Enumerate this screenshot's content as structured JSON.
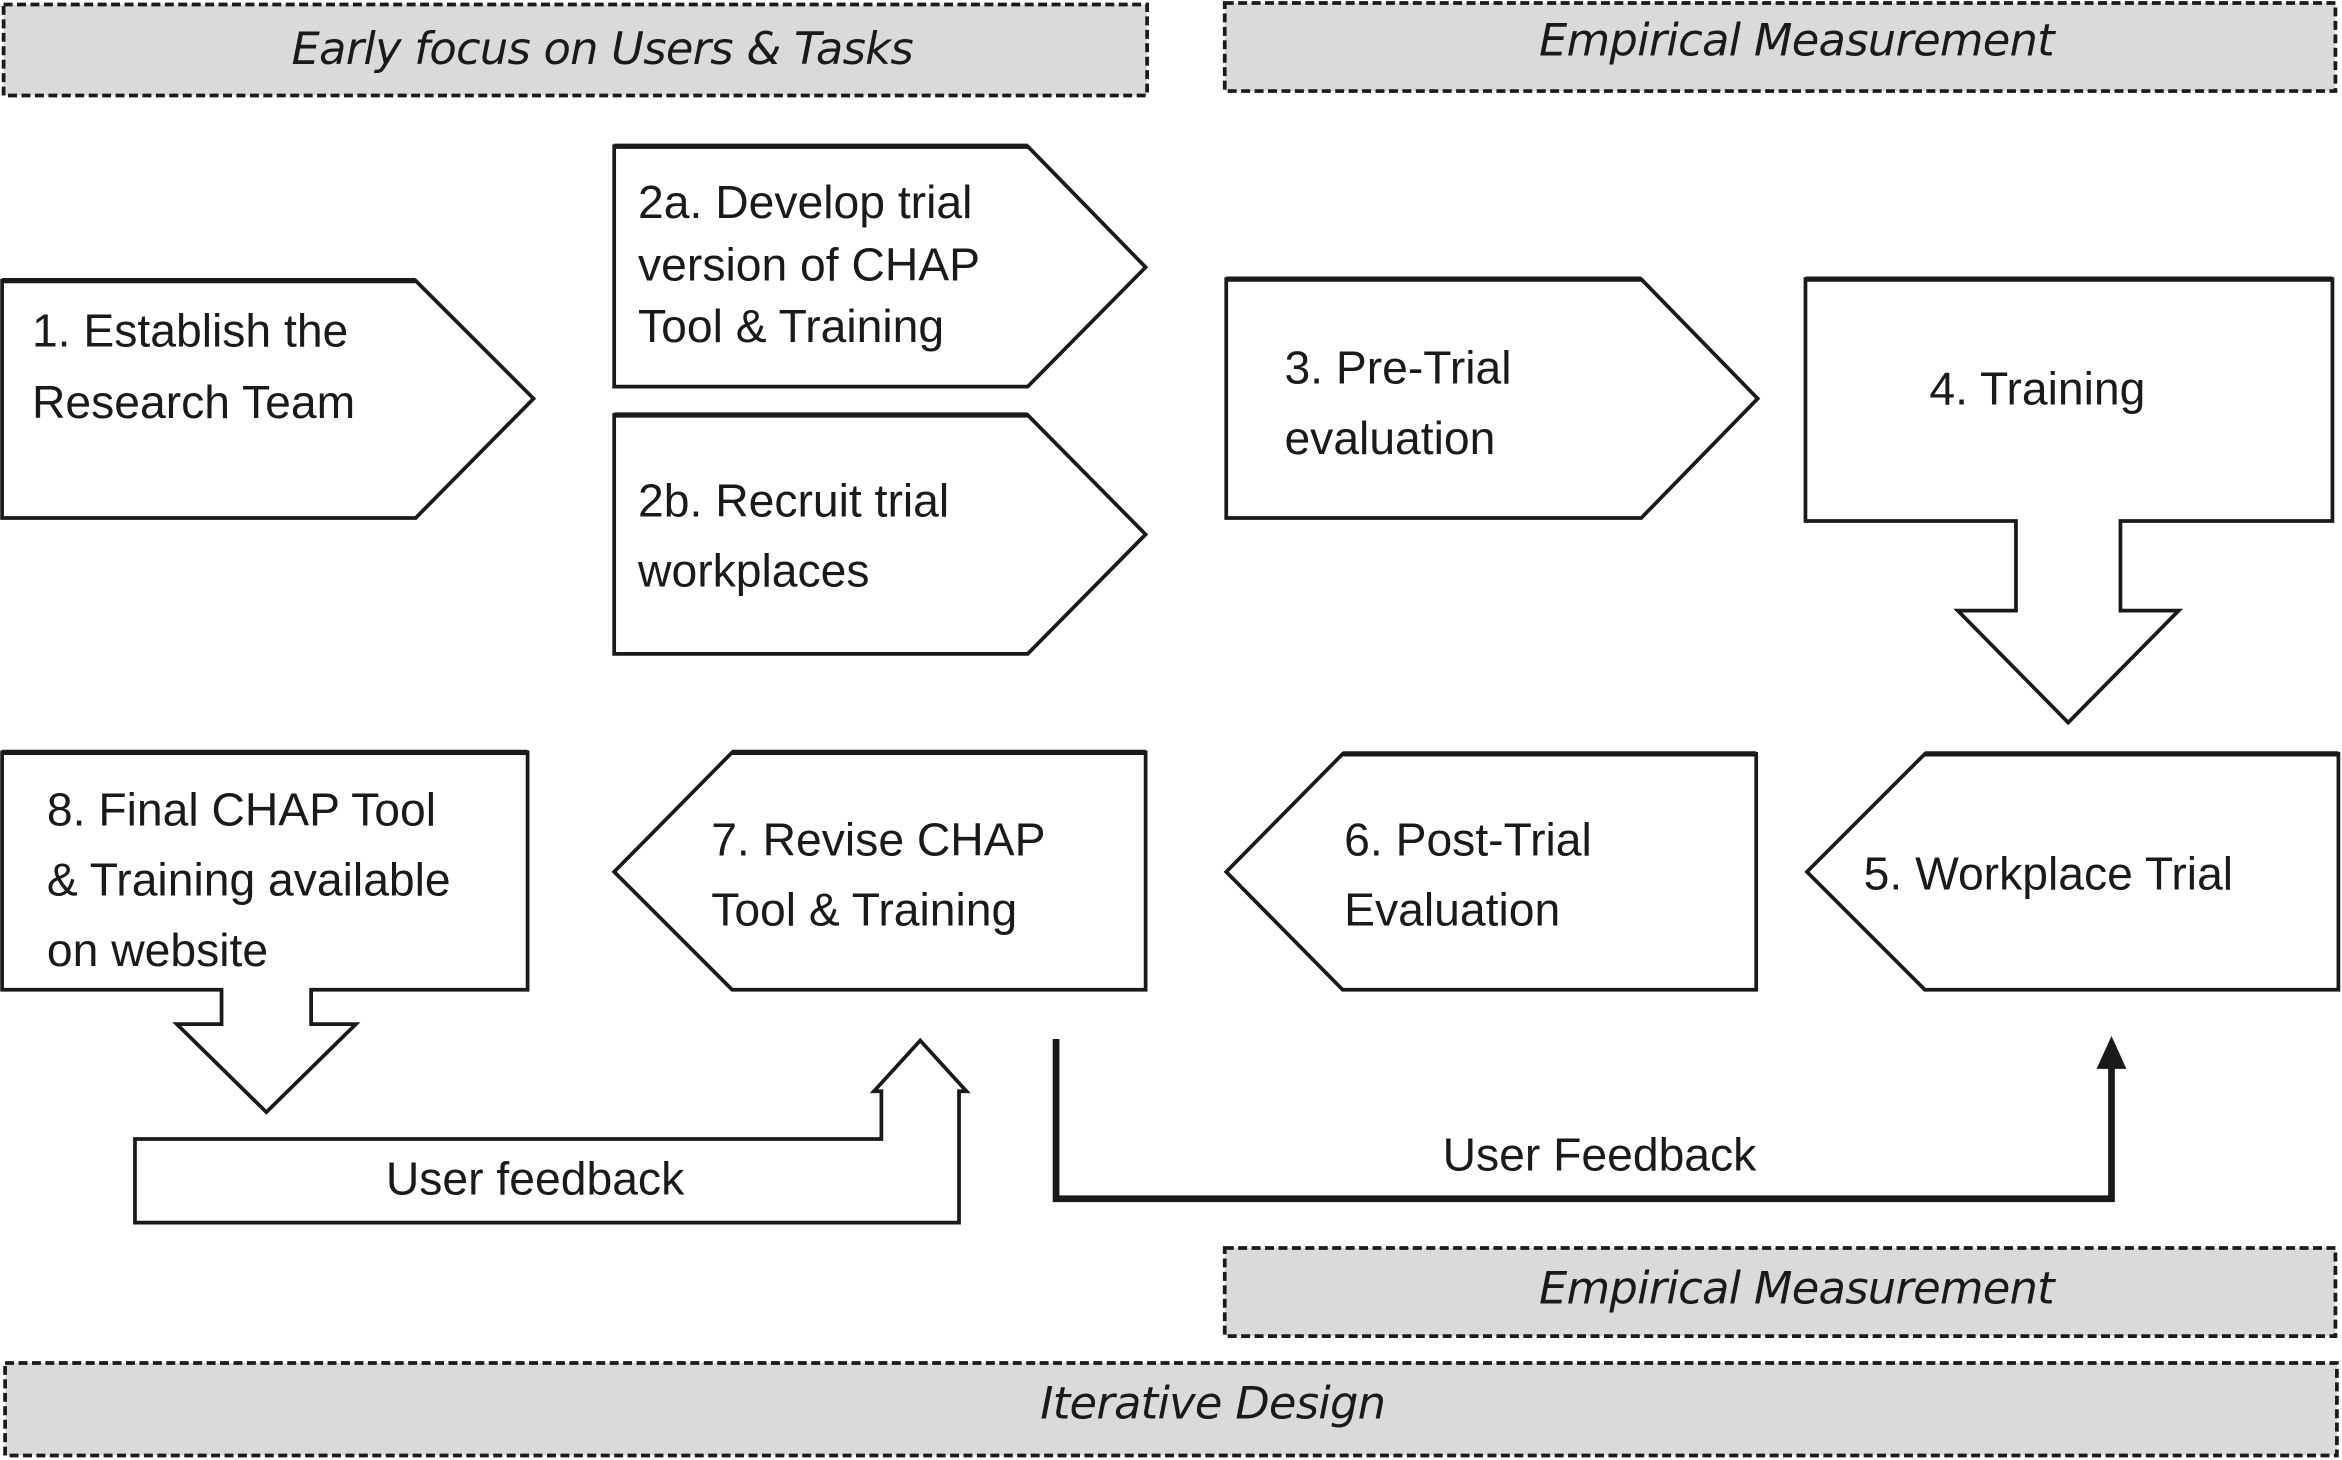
{
  "banners": {
    "early_focus": "Early focus on Users & Tasks",
    "empirical_top": "Empirical Measurement",
    "empirical_bottom": "Empirical Measurement",
    "iterative_design": "Iterative Design"
  },
  "steps": {
    "s1": {
      "lines": [
        "1. Establish the",
        "Research Team"
      ]
    },
    "s2a": {
      "lines": [
        "2a. Develop trial",
        "version of CHAP",
        "Tool & Training"
      ]
    },
    "s2b": {
      "lines": [
        "2b. Recruit trial",
        "workplaces"
      ]
    },
    "s3": {
      "lines": [
        "3. Pre-Trial",
        "evaluation"
      ]
    },
    "s4": {
      "lines": [
        "4. Training"
      ]
    },
    "s5": {
      "lines": [
        "5. Workplace Trial"
      ]
    },
    "s6": {
      "lines": [
        "6. Post-Trial",
        "Evaluation"
      ]
    },
    "s7": {
      "lines": [
        "7. Revise CHAP",
        "Tool & Training"
      ]
    },
    "s8": {
      "lines": [
        "8. Final CHAP Tool",
        "& Training available",
        "on website"
      ]
    }
  },
  "feedback": {
    "user_feedback_left": "User feedback",
    "user_feedback_right": "User Feedback"
  }
}
